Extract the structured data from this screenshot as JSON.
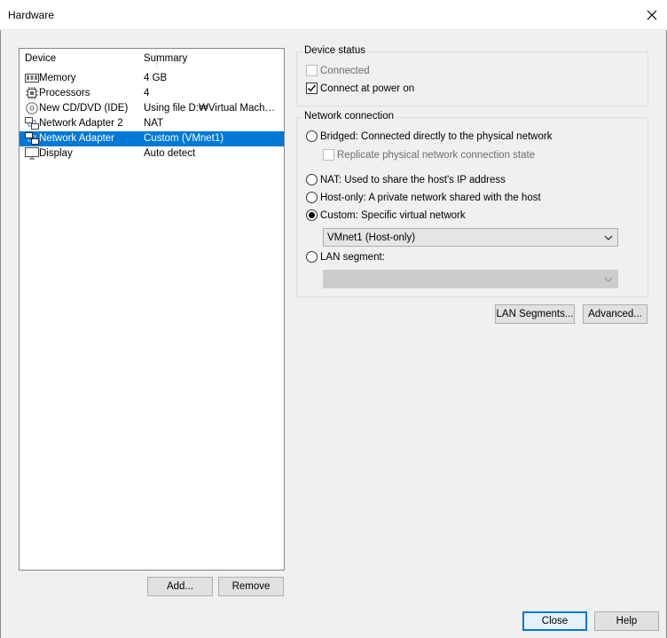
{
  "window": {
    "title": "Hardware"
  },
  "device_list": {
    "headers": {
      "device": "Device",
      "summary": "Summary"
    },
    "rows": [
      {
        "name": "Memory",
        "summary": "4 GB",
        "icon": "memory-icon"
      },
      {
        "name": "Processors",
        "summary": "4",
        "icon": "processor-icon"
      },
      {
        "name": "New CD/DVD (IDE)",
        "summary": "Using file D:₩Virtual Machin...",
        "icon": "cd-dvd-icon"
      },
      {
        "name": "Network Adapter 2",
        "summary": "NAT",
        "icon": "network-adapter-icon"
      },
      {
        "name": "Network Adapter",
        "summary": "Custom (VMnet1)",
        "icon": "network-adapter-icon"
      },
      {
        "name": "Display",
        "summary": "Auto detect",
        "icon": "display-icon"
      }
    ],
    "selected_index": 4
  },
  "buttons": {
    "add": "Add...",
    "remove": "Remove",
    "lan_segments": "LAN Segments...",
    "advanced": "Advanced...",
    "close": "Close",
    "help": "Help"
  },
  "device_status": {
    "title": "Device status",
    "connected": {
      "label": "Connected",
      "checked": false,
      "enabled": false
    },
    "connect_at_power_on": {
      "label": "Connect at power on",
      "checked": true,
      "enabled": true
    }
  },
  "network_connection": {
    "title": "Network connection",
    "bridged": "Bridged: Connected directly to the physical network",
    "replicate": "Replicate physical network connection state",
    "nat": "NAT: Used to share the host's IP address",
    "host_only": "Host-only: A private network shared with the host",
    "custom": "Custom: Specific virtual network",
    "custom_value": "VMnet1 (Host-only)",
    "lan_segment": "LAN segment:",
    "selected": "custom"
  },
  "colors": {
    "selection": "#0078d7",
    "dialog_bg": "#f0f0f0"
  }
}
